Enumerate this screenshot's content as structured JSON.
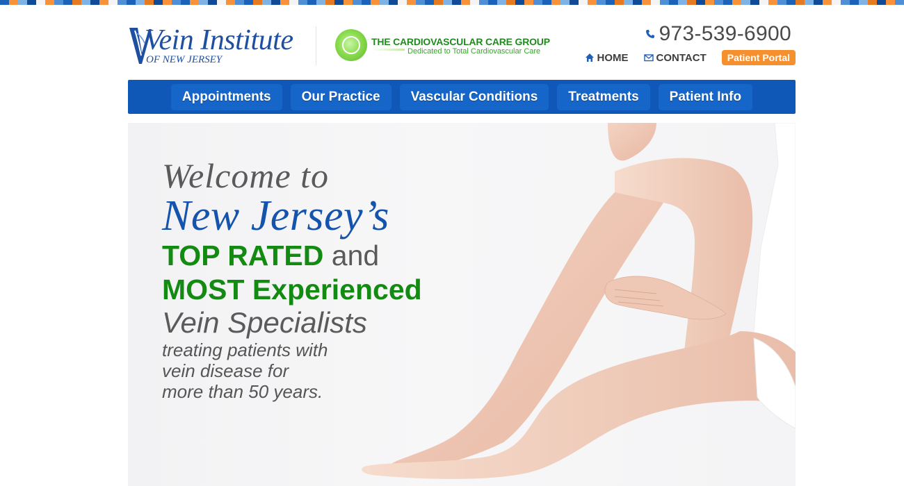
{
  "header": {
    "logo_title": "Vein Institute",
    "logo_subtitle": "OF NEW JERSEY",
    "partner_name": "THE CARDIOVASCULAR CARE GROUP",
    "partner_tagline": "Dedicated to Total Cardiovascular Care",
    "phone": "973-539-6900",
    "links": {
      "home": "HOME",
      "contact": "CONTACT",
      "portal": "Patient Portal"
    }
  },
  "nav": {
    "items": [
      {
        "label": "Appointments"
      },
      {
        "label": "Our Practice"
      },
      {
        "label": "Vascular Conditions"
      },
      {
        "label": "Treatments"
      },
      {
        "label": "Patient Info"
      }
    ]
  },
  "hero": {
    "welcome": "Welcome to",
    "state": "New Jersey’s",
    "top_rated": "TOP RATED",
    "and": "and",
    "most_experienced": "MOST Experienced",
    "specialists": "Vein Specialists",
    "desc_line1": "treating patients with",
    "desc_line2": "vein disease for",
    "desc_line3": "more than 50 years."
  },
  "colors": {
    "brand_blue": "#0f58b7",
    "nav_pill": "#1666c9",
    "accent_green": "#138a12",
    "portal_orange": "#f6902e",
    "strip": [
      "#1c62b8",
      "#f7923a",
      "#7fb2e5",
      "#f4f4f4",
      "#114a97",
      "#e67a22",
      "#4f8fd6"
    ]
  },
  "icons": {
    "phone": "phone-icon",
    "home": "home-icon",
    "contact": "envelope-icon",
    "logo_mark": "vein-v-logo-icon",
    "partner_mark": "apple-icon"
  }
}
